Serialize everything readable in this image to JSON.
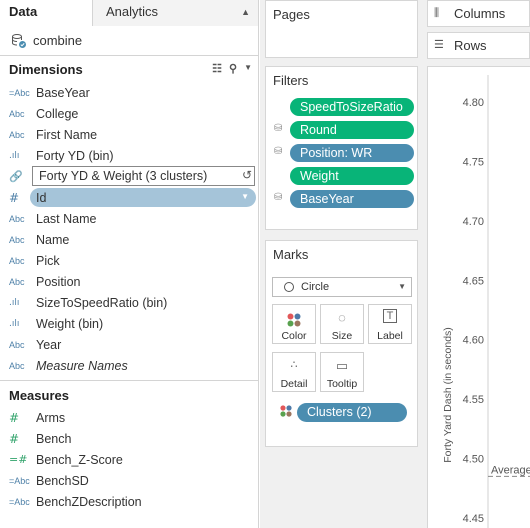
{
  "data_pane": {
    "tabs": {
      "data": "Data",
      "analytics": "Analytics"
    },
    "datasource": "combine",
    "dimensions_title": "Dimensions",
    "dimensions": [
      {
        "icon": "=Abc",
        "label": "BaseYear"
      },
      {
        "icon": "Abc",
        "label": "College"
      },
      {
        "icon": "Abc",
        "label": "First Name"
      },
      {
        "icon": "bin",
        "label": "Forty YD (bin)"
      },
      {
        "icon": "paperclip",
        "label": "Forty YD & Weight (3 clusters)",
        "editing": true
      },
      {
        "icon": "#",
        "label": "Id",
        "selected": true
      },
      {
        "icon": "Abc",
        "label": "Last Name"
      },
      {
        "icon": "Abc",
        "label": "Name"
      },
      {
        "icon": "Abc",
        "label": "Pick"
      },
      {
        "icon": "Abc",
        "label": "Position"
      },
      {
        "icon": "bin",
        "label": "SizeToSpeedRatio (bin)"
      },
      {
        "icon": "bin",
        "label": "Weight (bin)"
      },
      {
        "icon": "Abc",
        "label": "Year"
      },
      {
        "icon": "Abc",
        "label": "Measure Names",
        "italic": true
      }
    ],
    "measures_title": "Measures",
    "measures": [
      {
        "icon": "#",
        "label": "Arms"
      },
      {
        "icon": "#",
        "label": "Bench"
      },
      {
        "icon": "=#",
        "label": "Bench_Z-Score"
      },
      {
        "icon": "=Abc",
        "label": "BenchSD"
      },
      {
        "icon": "=Abc",
        "label": "BenchZDescription"
      }
    ]
  },
  "pages_title": "Pages",
  "filters": {
    "title": "Filters",
    "items": [
      {
        "label": "SpeedToSizeRatio",
        "color": "green",
        "icon": ""
      },
      {
        "label": "Round",
        "color": "green",
        "icon": "db"
      },
      {
        "label": "Position: WR",
        "color": "blue",
        "icon": "db"
      },
      {
        "label": "Weight",
        "color": "green",
        "icon": ""
      },
      {
        "label": "BaseYear",
        "color": "blue",
        "icon": "db"
      }
    ]
  },
  "marks": {
    "title": "Marks",
    "mark_type": "Circle",
    "buttons": {
      "color": "Color",
      "size": "Size",
      "label": "Label",
      "detail": "Detail",
      "tooltip": "Tooltip"
    },
    "color_pill": "Clusters (2)"
  },
  "columns_label": "Columns",
  "rows_label": "Rows",
  "chart_data": {
    "type": "scatter",
    "ylabel": "Forty Yard Dash (in seconds)",
    "y_ticks": [
      "4.80",
      "4.75",
      "4.70",
      "4.65",
      "4.60",
      "4.55",
      "4.50",
      "4.45"
    ],
    "ylim": [
      4.45,
      4.8
    ],
    "reference_line": {
      "label": "Average",
      "value": 4.485
    }
  },
  "colors": {
    "green_pill": "#08b478",
    "blue_pill": "#4b8db0",
    "selected_field": "#a5c4d9"
  }
}
